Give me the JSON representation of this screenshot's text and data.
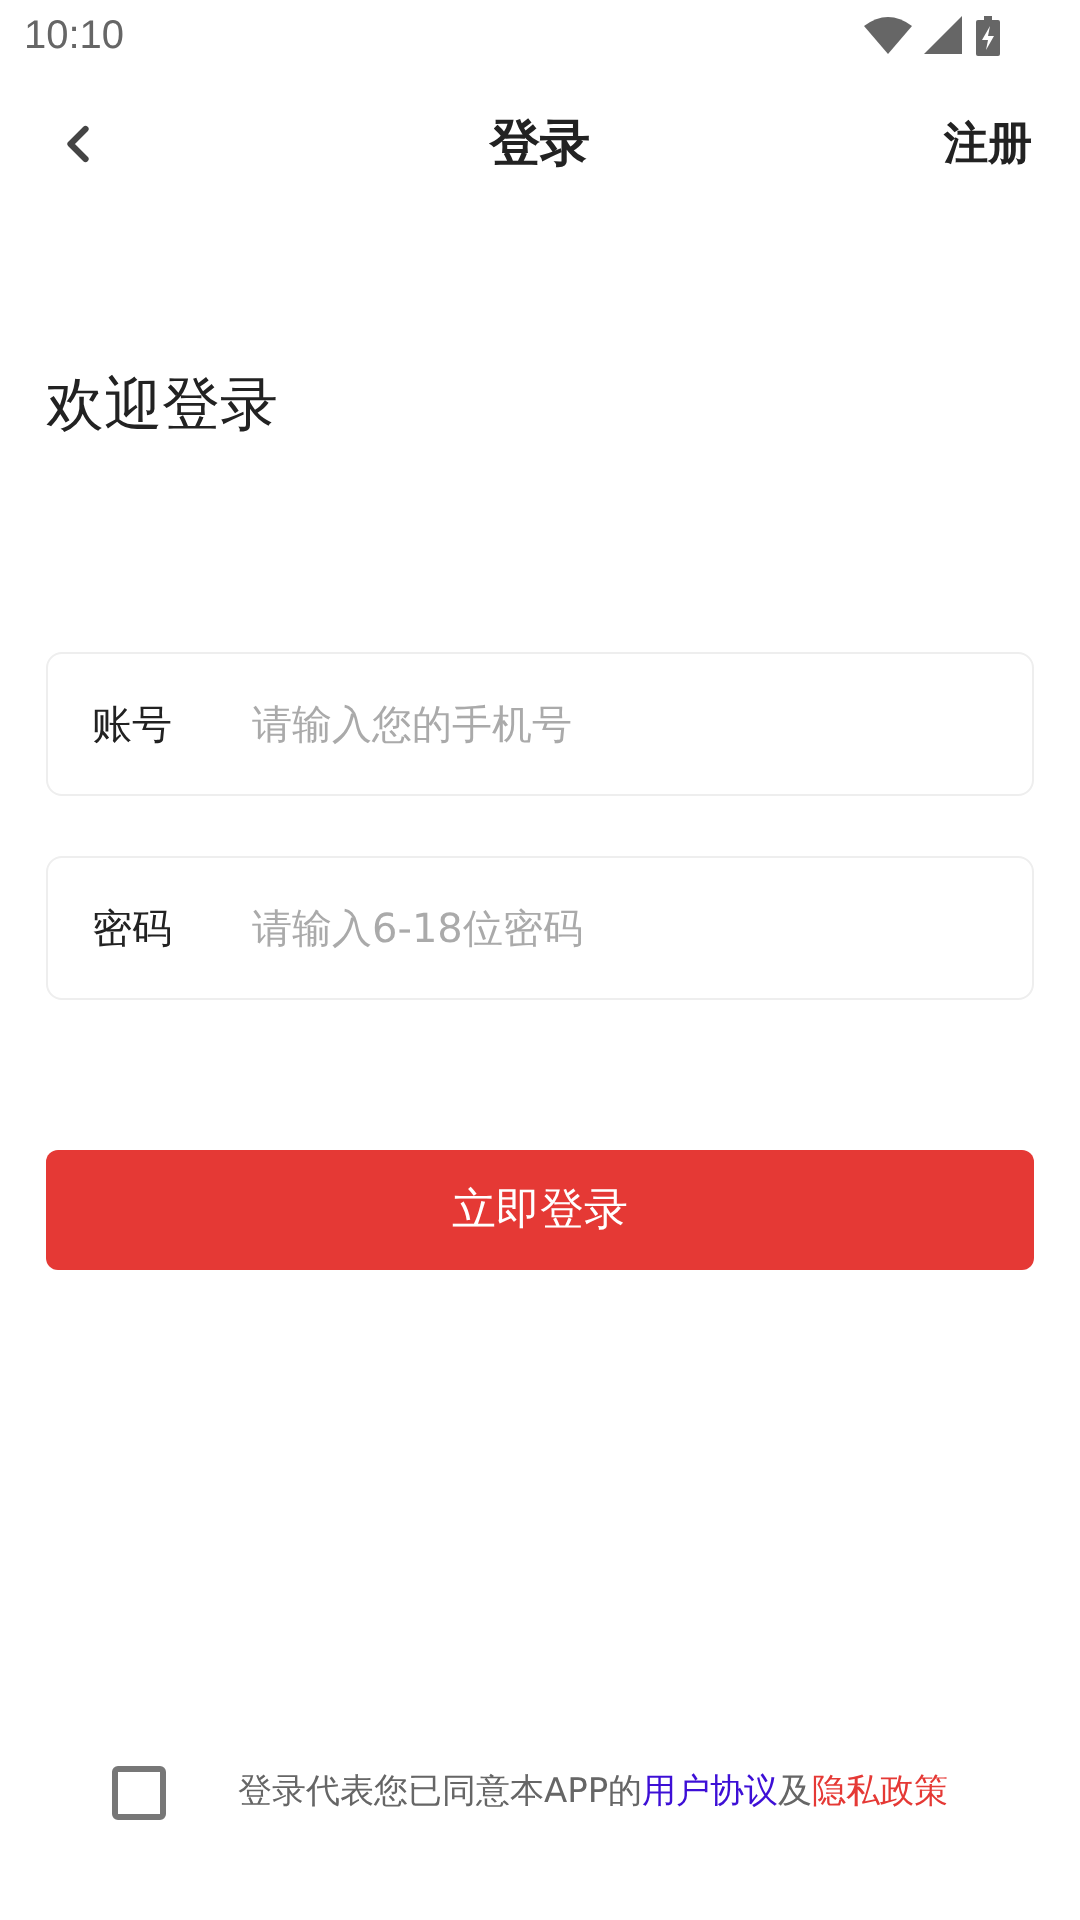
{
  "status_bar": {
    "time": "10:10"
  },
  "header": {
    "title": "登录",
    "action": "注册"
  },
  "welcome": "欢迎登录",
  "fields": [
    {
      "label": "账号",
      "placeholder": "请输入您的手机号"
    },
    {
      "label": "密码",
      "placeholder": "请输入6-18位密码"
    }
  ],
  "submit": "立即登录",
  "agreement": {
    "checked": false,
    "parts": [
      {
        "kind": "text",
        "text": "登录代表您已同意本APP的"
      },
      {
        "kind": "link",
        "text": "用户协议",
        "color": "#3d0fd6"
      },
      {
        "kind": "text",
        "text": "及"
      },
      {
        "kind": "link",
        "text": "隐私政策",
        "color": "#e53935"
      }
    ]
  }
}
